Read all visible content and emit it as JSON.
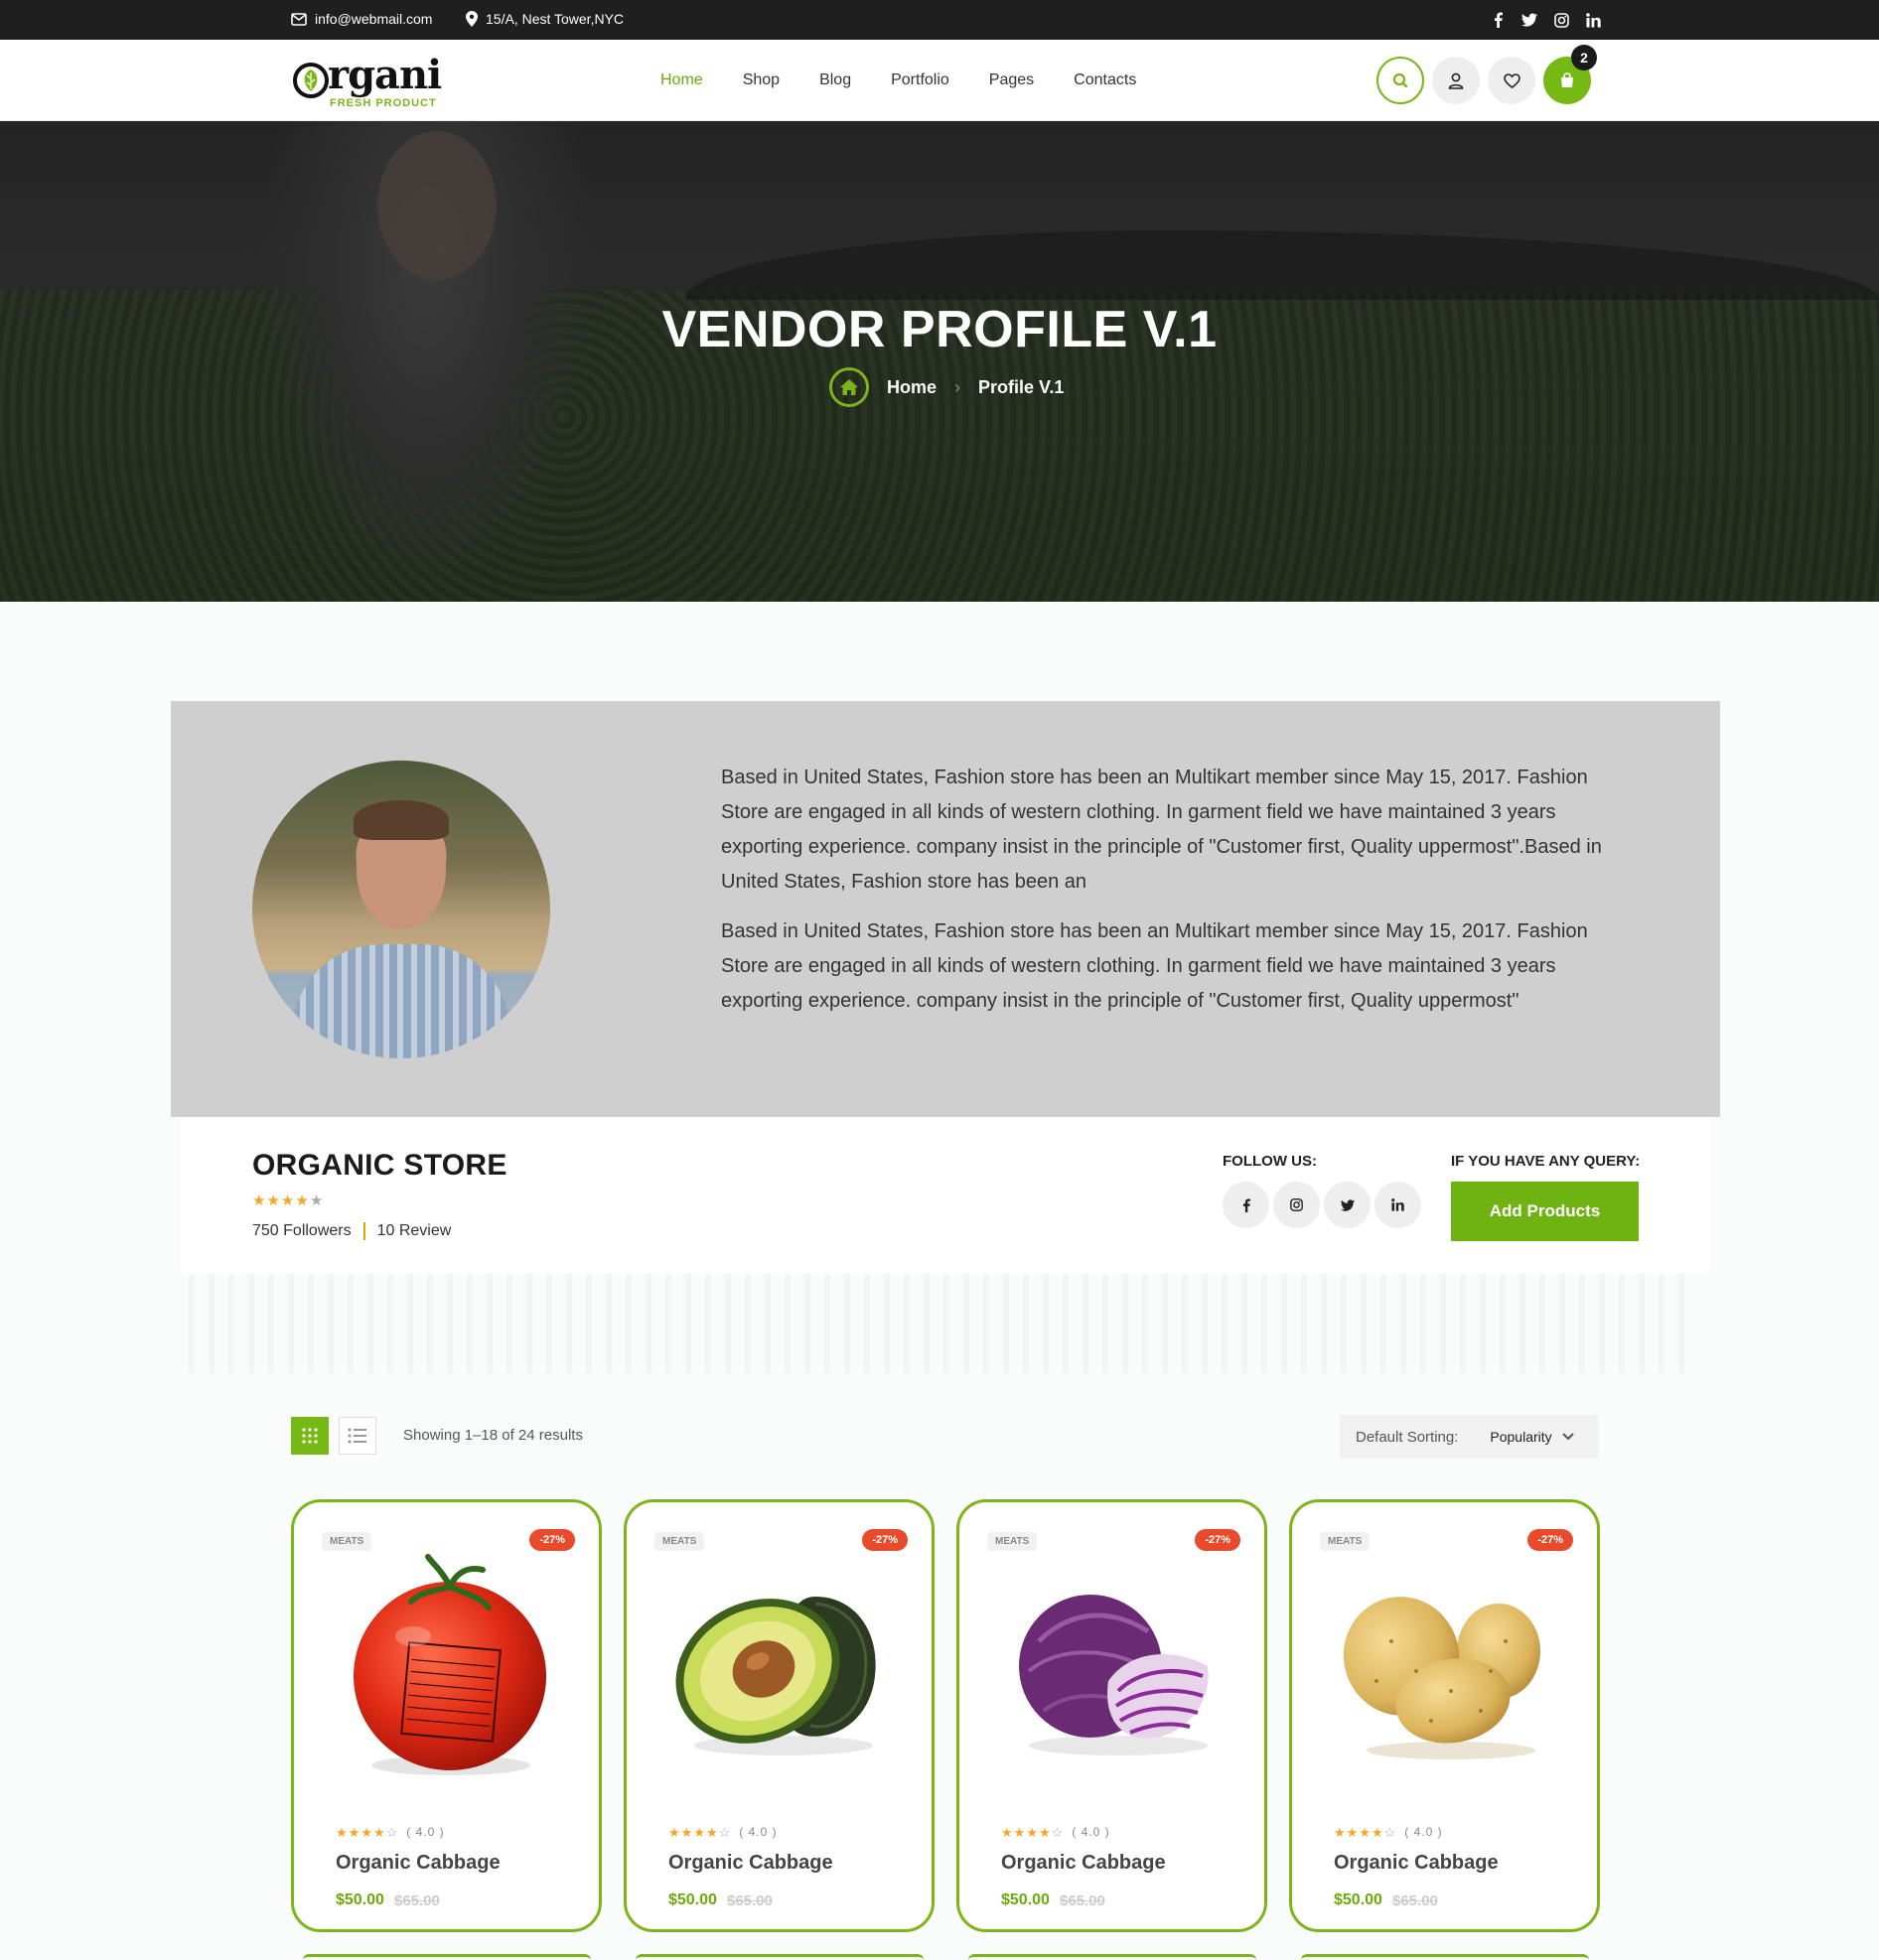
{
  "topbar": {
    "email": "info@webmail.com",
    "address": "15/A, Nest Tower,NYC",
    "social": [
      "facebook-icon",
      "twitter-icon",
      "instagram-icon",
      "linkedin-icon"
    ]
  },
  "header": {
    "logo_text": "rgani",
    "logo_sub": "FRESH PRODUCT",
    "nav": [
      {
        "label": "Home",
        "active": true
      },
      {
        "label": "Shop",
        "active": false
      },
      {
        "label": "Blog",
        "active": false
      },
      {
        "label": "Portfolio",
        "active": false
      },
      {
        "label": "Pages",
        "active": false
      },
      {
        "label": "Contacts",
        "active": false
      }
    ],
    "cart_count": "2"
  },
  "hero": {
    "title": "VENDOR PROFILE V.1",
    "breadcrumb_home": "Home",
    "breadcrumb_current": "Profile V.1"
  },
  "vendor": {
    "para1": "Based in United States, Fashion store has been an Multikart member since May 15, 2017. Fashion Store are engaged in all kinds of western clothing. In garment field we have maintained 3 years exporting experience. company insist in the principle of \"Customer first, Quality uppermost\".Based in United States, Fashion store has been an",
    "para2": "Based in United States, Fashion store has been an Multikart member since May 15, 2017. Fashion Store are engaged in all kinds of western clothing. In garment field we have maintained 3 years exporting experience. company insist in the principle of \"Customer first, Quality uppermost\"",
    "store_name": "ORGANIC STORE",
    "rating": 4,
    "followers": "750 Followers",
    "reviews": "10 Review",
    "follow_label": "FOLLOW US:",
    "query_label": "IF YOU HAVE ANY QUERY:",
    "add_button": "Add Products"
  },
  "toolbar": {
    "results": "Showing 1–18 of 24 results",
    "sort_label": "Default Sorting:",
    "sort_value": "Popularity"
  },
  "products": [
    {
      "category": "MEATS",
      "discount": "-27%",
      "rating": "( 4.0 )",
      "name": "Organic Cabbage",
      "price": "$50.00",
      "old_price": "$65.00",
      "image": "tomato"
    },
    {
      "category": "MEATS",
      "discount": "-27%",
      "rating": "( 4.0 )",
      "name": "Organic Cabbage",
      "price": "$50.00",
      "old_price": "$65.00",
      "image": "avocado"
    },
    {
      "category": "MEATS",
      "discount": "-27%",
      "rating": "( 4.0 )",
      "name": "Organic Cabbage",
      "price": "$50.00",
      "old_price": "$65.00",
      "image": "red-cabbage"
    },
    {
      "category": "MEATS",
      "discount": "-27%",
      "rating": "( 4.0 )",
      "name": "Organic Cabbage",
      "price": "$50.00",
      "old_price": "$65.00",
      "image": "potatoes"
    }
  ],
  "colors": {
    "accent": "#76b914",
    "discount": "#e84a2c",
    "topbar": "#1f1f1f"
  }
}
